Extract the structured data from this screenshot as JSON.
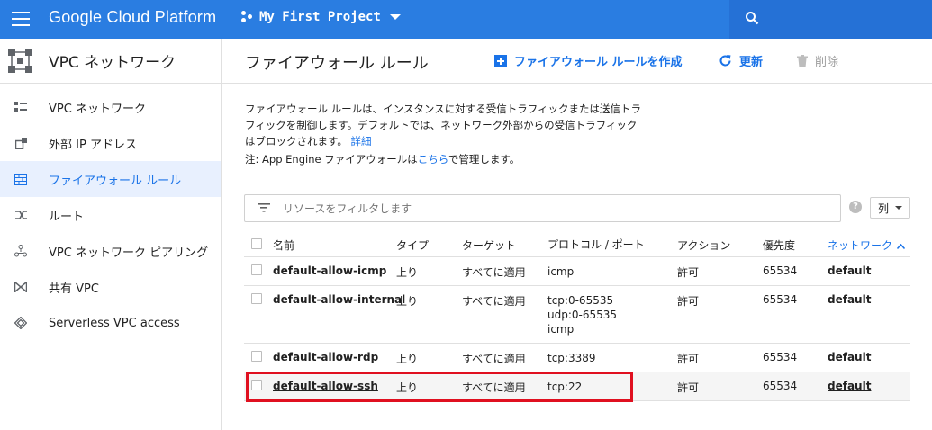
{
  "topbar": {
    "brand": "Google Cloud Platform",
    "project": "My First Project",
    "colors": {
      "bar": "#2a7de1",
      "search": "#2571d6"
    }
  },
  "sidebar": {
    "title": "VPC ネットワーク",
    "items": [
      {
        "label": "VPC ネットワーク",
        "icon": "vpc-network-icon"
      },
      {
        "label": "外部 IP アドレス",
        "icon": "external-ip-icon"
      },
      {
        "label": "ファイアウォール ルール",
        "icon": "firewall-icon",
        "active": true
      },
      {
        "label": "ルート",
        "icon": "route-icon"
      },
      {
        "label": "VPC ネットワーク ピアリング",
        "icon": "peering-icon"
      },
      {
        "label": "共有 VPC",
        "icon": "shared-vpc-icon"
      },
      {
        "label": "Serverless VPC access",
        "icon": "serverless-icon"
      }
    ]
  },
  "header": {
    "title": "ファイアウォール ルール",
    "create_label": "ファイアウォール ルールを作成",
    "refresh_label": "更新",
    "delete_label": "削除"
  },
  "description": {
    "text": "ファイアウォール ルールは、インスタンスに対する受信トラフィックまたは送信トラフィックを制御します。デフォルトでは、ネットワーク外部からの受信トラフィックはブロックされます。",
    "link": "詳細",
    "note_prefix": "注: App Engine ファイアウォールは",
    "note_link": "こちら",
    "note_suffix": "で管理します。"
  },
  "filter": {
    "placeholder": "リソースをフィルタします",
    "columns_label": "列"
  },
  "table": {
    "headers": {
      "name": "名前",
      "type": "タイプ",
      "target": "ターゲット",
      "protocol": "プロトコル / ポート",
      "action": "アクション",
      "priority": "優先度",
      "network": "ネットワーク"
    },
    "rows": [
      {
        "name": "default-allow-icmp",
        "type": "上り",
        "target": "すべてに適用",
        "protocol": [
          "icmp"
        ],
        "action": "許可",
        "priority": "65534",
        "network": "default"
      },
      {
        "name": "default-allow-internal",
        "type": "上り",
        "target": "すべてに適用",
        "protocol": [
          "tcp:0-65535",
          "udp:0-65535",
          "icmp"
        ],
        "action": "許可",
        "priority": "65534",
        "network": "default"
      },
      {
        "name": "default-allow-rdp",
        "type": "上り",
        "target": "すべてに適用",
        "protocol": [
          "tcp:3389"
        ],
        "action": "許可",
        "priority": "65534",
        "network": "default"
      },
      {
        "name": "default-allow-ssh",
        "type": "上り",
        "target": "すべてに適用",
        "protocol": [
          "tcp:22"
        ],
        "action": "許可",
        "priority": "65534",
        "network": "default",
        "highlighted": true
      }
    ]
  }
}
